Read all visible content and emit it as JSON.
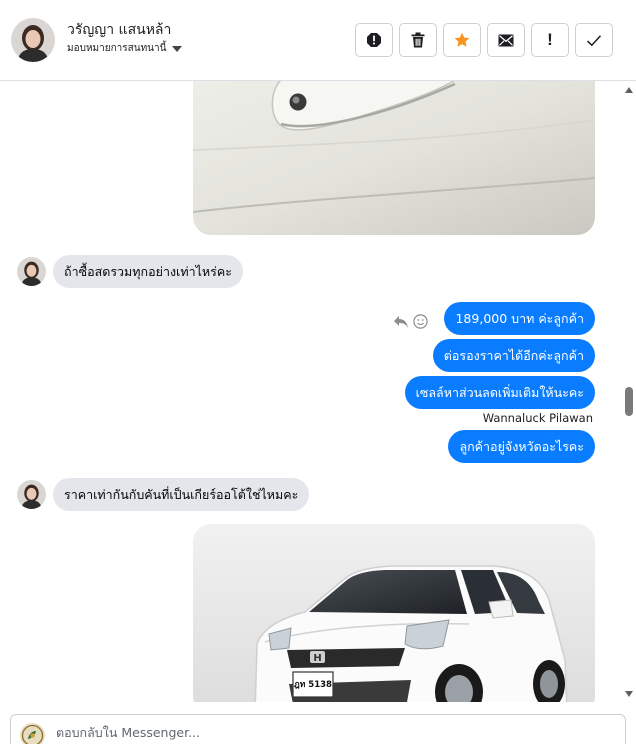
{
  "header": {
    "contact_name": "วรัญญา แสนหล้า",
    "assign_label": "มอบหมายการสนทนานี้",
    "toolbar": [
      {
        "name": "report-spam-button",
        "icon": "octagon-alert-icon"
      },
      {
        "name": "delete-button",
        "icon": "trash-icon"
      },
      {
        "name": "star-button",
        "icon": "star-icon",
        "accent": "#f7931e"
      },
      {
        "name": "mark-unread-button",
        "icon": "envelope-icon"
      },
      {
        "name": "follow-up-button",
        "icon": "exclamation-icon",
        "label": "!"
      },
      {
        "name": "mark-done-button",
        "icon": "checkmark-icon"
      }
    ]
  },
  "messages": {
    "incoming_1": "ถ้าซื้อสดรวมทุกอย่างเท่าไหร่คะ",
    "outgoing_1": "189,000 บาท ค่ะลูกค้า",
    "outgoing_2": "ต่อรองราคาได้อีกค่ะลูกค้า",
    "outgoing_3": "เซลล์หาส่วนลดเพิ่มเติมให้นะคะ",
    "sender_label": "Wannaluck Pilawan",
    "outgoing_4": "ลูกค้าอยู่จังหวัดอะไรคะ",
    "incoming_2": "ราคาเท่ากันกับคันที่เป็นเกียร์ออโต้ใช่ไหมคะ",
    "car_plate_text": "ฎท 5138"
  },
  "composer": {
    "placeholder": "ตอบกลับใน Messenger..."
  },
  "colors": {
    "outgoing_bubble": "#0a7cff",
    "incoming_bubble": "#e4e6eb",
    "star_accent": "#f7931e"
  }
}
